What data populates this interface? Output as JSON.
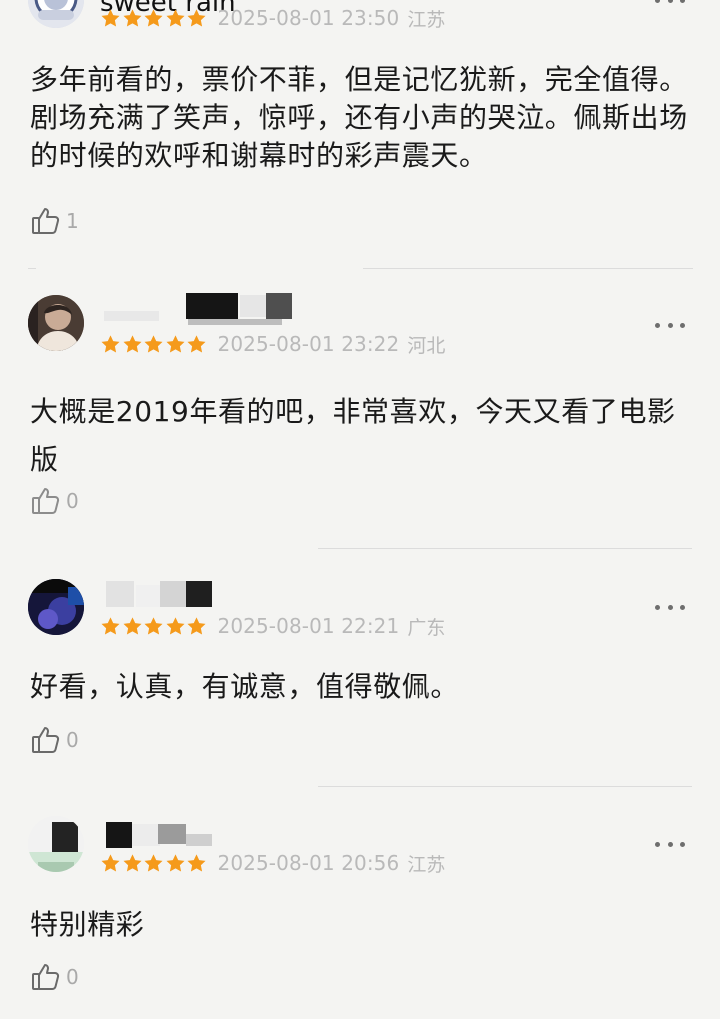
{
  "accent": {
    "star": "#f59a1b",
    "meta_gray": "#b9b9b9",
    "divider": "#dcdcdc"
  },
  "reviews": [
    {
      "username": "sweet rain",
      "rating": 5,
      "date": "2025-08-01 23:50",
      "region": "江苏",
      "text": "多年前看的，票价不菲，但是记忆犹新，完全值得。剧场充满了笑声，惊呼，还有小声的哭泣。佩斯出场的时候的欢呼和谢幕时的彩声震天。",
      "likes": "1"
    },
    {
      "username": "",
      "rating": 5,
      "date": "2025-08-01 23:22",
      "region": "河北",
      "text": "大概是2019年看的吧，非常喜欢，今天又看了电影版",
      "likes": "0"
    },
    {
      "username": "",
      "rating": 5,
      "date": "2025-08-01 22:21",
      "region": "广东",
      "text": "好看，认真，有诚意，值得敬佩。",
      "likes": "0"
    },
    {
      "username": "",
      "rating": 5,
      "date": "2025-08-01 20:56",
      "region": "江苏",
      "text": "特别精彩",
      "likes": "0"
    }
  ]
}
